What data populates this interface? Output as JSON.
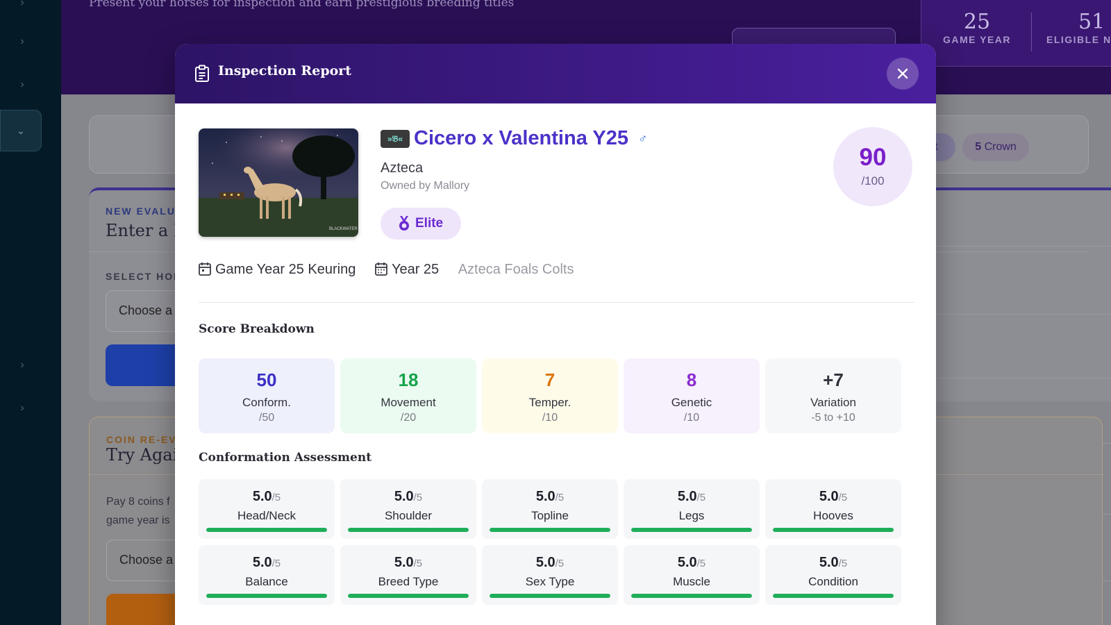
{
  "header": {
    "subtitle": "Present your horses for inspection and earn prestigious breeding titles",
    "stats": [
      {
        "value": "25",
        "label": "GAME YEAR"
      },
      {
        "value": "51",
        "label": "ELIGIBLE N"
      }
    ]
  },
  "filters": {
    "crown_count": "5",
    "crown_label": "Crown",
    "prev_pill_fragment": "t"
  },
  "new_eval": {
    "eyebrow": "NEW EVALU",
    "title": "Enter a H",
    "select_label": "SELECT HOR",
    "select_placeholder": "Choose a"
  },
  "coin_reeval": {
    "eyebrow": "COIN RE-EV",
    "title": "Try Agai",
    "text_line1": "Pay 8 coins f",
    "text_line2": "game year is",
    "select_placeholder": "Choose a"
  },
  "modal": {
    "title": "Inspection Report",
    "horse": {
      "breed_badge": "»𝔅«",
      "name": "Cicero x Valentina Y25",
      "sex_symbol": "♂",
      "breed": "Azteca",
      "owner": "Owned by Mallory",
      "award": "Elite",
      "image_watermark": "BLACKWATER"
    },
    "total_score": {
      "value": "90",
      "max": "/100",
      "fraction": 0.9
    },
    "meta": {
      "event": "Game Year 25 Keuring",
      "year": "Year 25",
      "class": "Azteca Foals Colts"
    },
    "score_breakdown_title": "Score Breakdown",
    "score_breakdown": [
      {
        "value": "50",
        "label": "Conform.",
        "max": "/50",
        "color": "#3a2fc4",
        "bg": "#eef0fc"
      },
      {
        "value": "18",
        "label": "Movement",
        "max": "/20",
        "color": "#16a34a",
        "bg": "#ebfbf1"
      },
      {
        "value": "7",
        "label": "Temper.",
        "max": "/10",
        "color": "#d9770a",
        "bg": "#fefbe9"
      },
      {
        "value": "8",
        "label": "Genetic",
        "max": "/10",
        "color": "#8a2bd0",
        "bg": "#f7f0fd"
      },
      {
        "value": "+7",
        "label": "Variation",
        "max": "-5 to +10",
        "color": "#33333d",
        "bg": "#f6f7f9"
      }
    ],
    "conformation_title": "Conformation Assessment",
    "conformation": [
      {
        "score": "5.0",
        "max": "/5",
        "label": "Head/Neck",
        "fraction": 1.0
      },
      {
        "score": "5.0",
        "max": "/5",
        "label": "Shoulder",
        "fraction": 1.0
      },
      {
        "score": "5.0",
        "max": "/5",
        "label": "Topline",
        "fraction": 1.0
      },
      {
        "score": "5.0",
        "max": "/5",
        "label": "Legs",
        "fraction": 1.0
      },
      {
        "score": "5.0",
        "max": "/5",
        "label": "Hooves",
        "fraction": 1.0
      },
      {
        "score": "5.0",
        "max": "/5",
        "label": "Balance",
        "fraction": 1.0
      },
      {
        "score": "5.0",
        "max": "/5",
        "label": "Breed Type",
        "fraction": 1.0
      },
      {
        "score": "5.0",
        "max": "/5",
        "label": "Sex Type",
        "fraction": 1.0
      },
      {
        "score": "5.0",
        "max": "/5",
        "label": "Muscle",
        "fraction": 1.0
      },
      {
        "score": "5.0",
        "max": "/5",
        "label": "Condition",
        "fraction": 1.0
      }
    ]
  }
}
